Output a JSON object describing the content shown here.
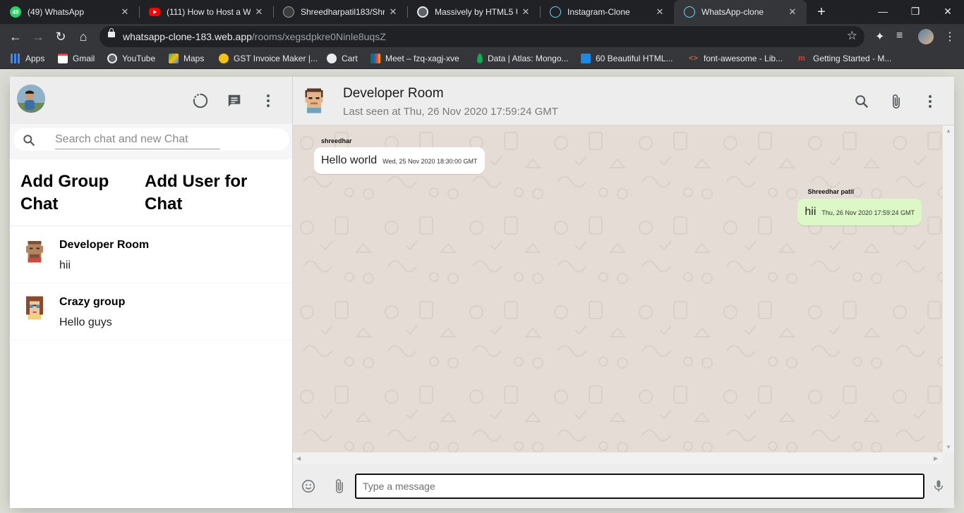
{
  "browser": {
    "tabs": [
      {
        "title": "(49) WhatsApp",
        "favicon": "whatsapp-icon",
        "badge": "49"
      },
      {
        "title": "(111) How to Host a We",
        "favicon": "youtube-icon"
      },
      {
        "title": "Shreedharpatil183/Shre",
        "favicon": "github-icon"
      },
      {
        "title": "Massively by HTML5 UP",
        "favicon": "globe-icon"
      },
      {
        "title": "Instagram-Clone",
        "favicon": "react-icon"
      },
      {
        "title": "WhatsApp-clone",
        "favicon": "react-icon",
        "active": true
      }
    ],
    "url_host": "whatsapp-clone-183.web.app",
    "url_path": "/rooms/xegsdpkre0Ninle8uqsZ",
    "bookmarks": [
      {
        "label": "Apps",
        "icon": "apps-grid-icon"
      },
      {
        "label": "Gmail",
        "icon": "gmail-icon"
      },
      {
        "label": "YouTube",
        "icon": "globe-icon"
      },
      {
        "label": "Maps",
        "icon": "maps-icon"
      },
      {
        "label": "GST Invoice Maker |...",
        "icon": "gst-icon"
      },
      {
        "label": "Cart",
        "icon": "cart-icon"
      },
      {
        "label": "Meet – fzq-xagj-xve",
        "icon": "meet-icon"
      },
      {
        "label": "Data | Atlas: Mongo...",
        "icon": "mongodb-leaf-icon"
      },
      {
        "label": "60 Beautiful HTML...",
        "icon": "f-icon"
      },
      {
        "label": "font-awesome - Lib...",
        "icon": "code-icon"
      },
      {
        "label": "Getting Started - M...",
        "icon": "m-icon"
      }
    ]
  },
  "sidebar": {
    "search_placeholder": "Search chat and new Chat",
    "add_group_label": "Add Group Chat",
    "add_user_label": "Add User for Chat",
    "chats": [
      {
        "name": "Developer Room",
        "last_message": "hii"
      },
      {
        "name": "Crazy group",
        "last_message": "Hello guys"
      }
    ]
  },
  "chat": {
    "room_name": "Developer Room",
    "last_seen": "Last seen at Thu, 26 Nov 2020 17:59:24 GMT",
    "messages": [
      {
        "sender": "shreedhar",
        "text": "Hello world",
        "timestamp": "Wed, 25 Nov 2020 18:30:00 GMT",
        "direction": "received"
      },
      {
        "sender": "Shreedhar patil",
        "text": "hii",
        "timestamp": "Thu, 26 Nov 2020 17:59:24 GMT",
        "direction": "sent"
      }
    ],
    "input_placeholder": "Type a message"
  },
  "colors": {
    "sent_bubble": "#dcf8c6",
    "received_bubble": "#ffffff",
    "chat_background": "#e5ddd5",
    "header_background": "#ededed"
  }
}
